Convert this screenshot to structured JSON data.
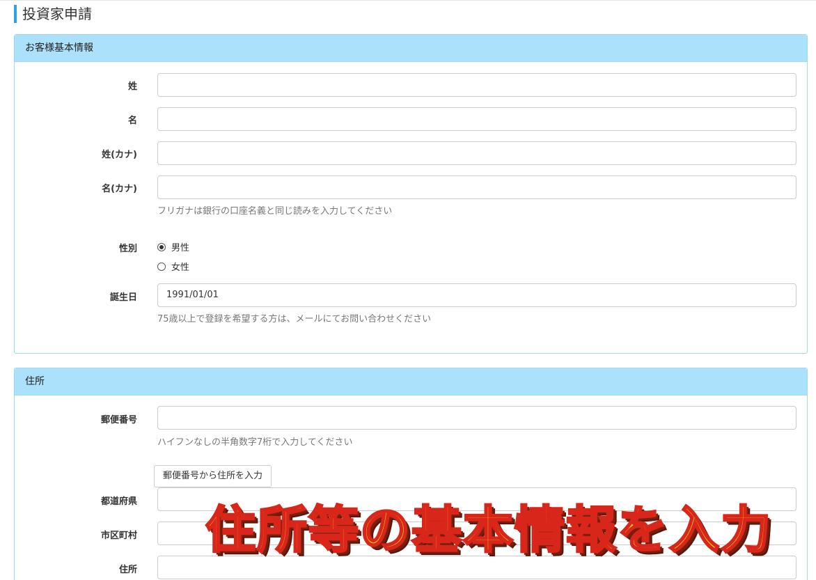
{
  "page_title": "投資家申請",
  "section1": {
    "heading": "お客様基本情報",
    "last_name_label": "姓",
    "first_name_label": "名",
    "last_name_kana_label": "姓(カナ)",
    "first_name_kana_label": "名(カナ)",
    "kana_help": "フリガナは銀行の口座名義と同じ読みを入力してください",
    "gender_label": "性別",
    "gender_options": [
      "男性",
      "女性"
    ],
    "gender_selected": "男性",
    "birthday_label": "誕生日",
    "birthday_value": "1991/01/01",
    "birthday_help": "75歳以上で登録を希望する方は、メールにてお問い合わせください"
  },
  "section2": {
    "heading": "住所",
    "postal_label": "郵便番号",
    "postal_help": "ハイフンなしの半角数字7桁で入力してください",
    "lookup_button": "郵便番号から住所を入力",
    "prefecture_label": "都道府県",
    "city_label": "市区町村",
    "address_label": "住所"
  },
  "overlay_caption": "住所等の基本情報を入力",
  "colors": {
    "accent": "#2aa3e0",
    "panel_heading_bg": "#abe1fa",
    "panel_border": "#9fd8ef",
    "caption_fill": "#ffd21a",
    "caption_stroke": "#d8261b"
  }
}
